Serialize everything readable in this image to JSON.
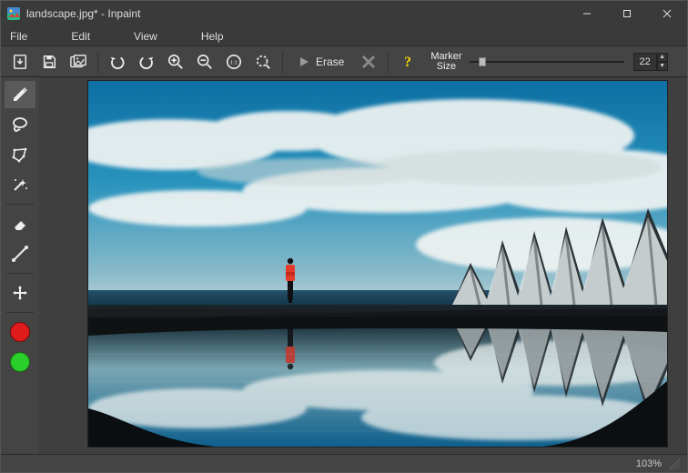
{
  "window": {
    "title": "landscape.jpg* - Inpaint"
  },
  "menu": {
    "file": "File",
    "edit": "Edit",
    "view": "View",
    "help": "Help"
  },
  "toolbar": {
    "open": "open-icon",
    "save": "save-icon",
    "batch": "batch-icon",
    "undo": "undo-icon",
    "redo": "redo-icon",
    "zoom_in": "zoom-in-icon",
    "zoom_out": "zoom-out-icon",
    "zoom_original": "zoom-1to1-icon",
    "zoom_fit": "zoom-fit-icon",
    "erase_label": "Erase",
    "cancel": "cancel-icon",
    "help": "help-icon",
    "marker_label_line1": "Marker",
    "marker_label_line2": "Size",
    "marker_size_value": "22",
    "marker_slider_min": 1,
    "marker_slider_max": 300,
    "marker_slider_pos_pct": 6
  },
  "tools": {
    "marker": "marker-tool",
    "lasso": "lasso-tool",
    "polygon": "polygon-tool",
    "magic_wand": "magic-wand-tool",
    "eraser": "eraser-tool",
    "line": "guide-line-tool",
    "move": "move-tool",
    "color_remove": "#e01b1b",
    "color_donor": "#2bcf2b"
  },
  "status": {
    "zoom": "103%"
  },
  "canvas": {
    "image_description": "Landscape photo: person in red jacket standing on dark rocky shore with calm reflective water, snowy jagged mountain range on the right, blue sky with white clouds, strong mirror reflection in foreground water."
  }
}
